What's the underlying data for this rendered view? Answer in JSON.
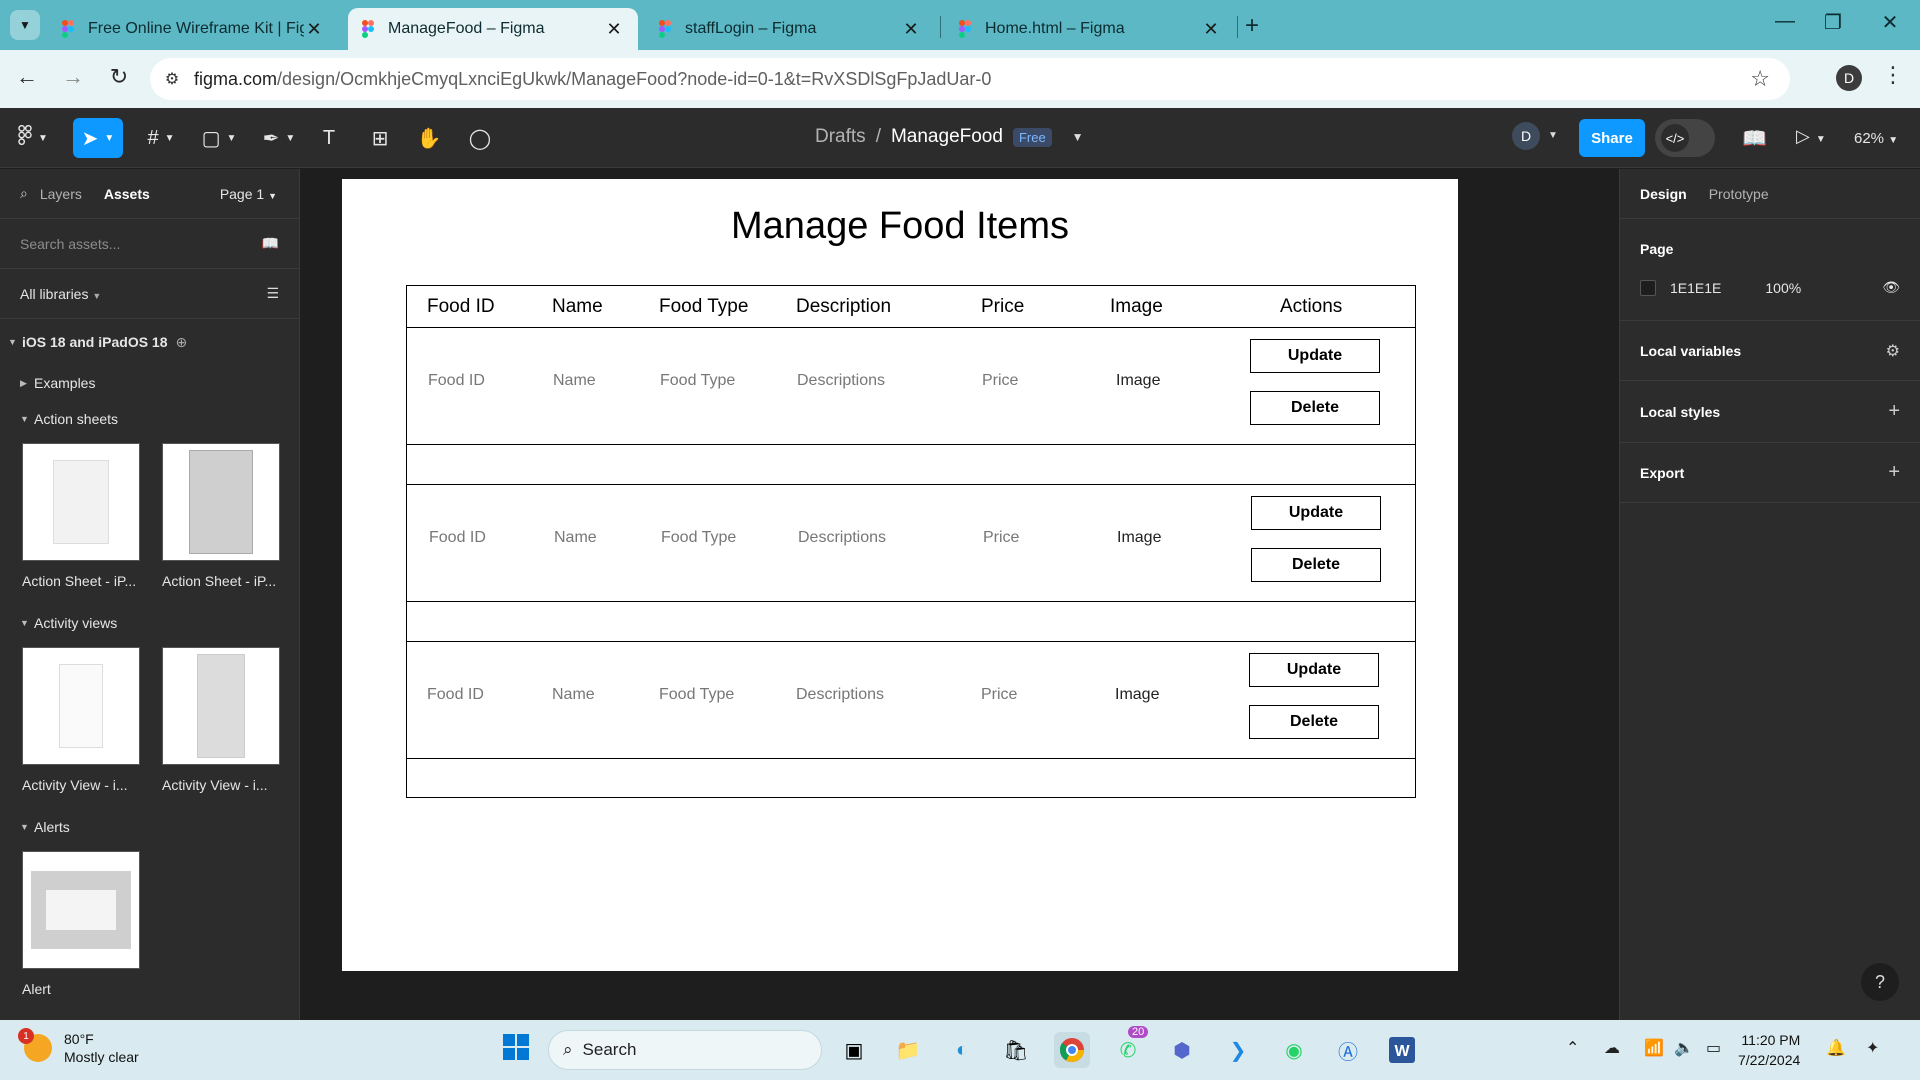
{
  "browser": {
    "tabs": [
      {
        "title": "Free Online Wireframe Kit | Figma",
        "active": false
      },
      {
        "title": "ManageFood – Figma",
        "active": true
      },
      {
        "title": "staffLogin – Figma",
        "active": false
      },
      {
        "title": "Home.html – Figma",
        "active": false
      }
    ],
    "url_host": "figma.com",
    "url_path": "/design/OcmkhjeCmyqLxnciEgUkwk/ManageFood?node-id=0-1&t=RvXSDlSgFpJadUar-0",
    "profile_initial": "D"
  },
  "figma_toolbar": {
    "breadcrumb_folder": "Drafts",
    "breadcrumb_sep": "/",
    "file_name": "ManageFood",
    "plan_badge": "Free",
    "user_initial": "D",
    "share_label": "Share",
    "zoom": "62%"
  },
  "left_panel": {
    "tab_layers": "Layers",
    "tab_assets": "Assets",
    "page_label": "Page 1",
    "search_placeholder": "Search assets...",
    "libraries_label": "All libraries",
    "library_name": "iOS 18 and iPadOS 18",
    "sections": {
      "examples": "Examples",
      "action_sheets": "Action sheets",
      "activity_views": "Activity views",
      "alerts": "Alerts"
    },
    "thumbnails": {
      "action_sheet_1": "Action Sheet - iP...",
      "action_sheet_2": "Action Sheet - iP...",
      "activity_view_1": "Activity View - i...",
      "activity_view_2": "Activity View - i...",
      "alert": "Alert"
    }
  },
  "frame": {
    "title": "Manage Food Items",
    "columns": [
      "Food ID",
      "Name",
      "Food Type",
      "Description",
      "Price",
      "Image",
      "Actions"
    ],
    "rows": [
      {
        "id": "Food ID",
        "name": "Name",
        "type": "Food Type",
        "desc": "Descriptions",
        "price": "Price",
        "image": "Image",
        "update": "Update",
        "delete": "Delete"
      },
      {
        "id": "Food ID",
        "name": "Name",
        "type": "Food Type",
        "desc": "Descriptions",
        "price": "Price",
        "image": "Image",
        "update": "Update",
        "delete": "Delete"
      },
      {
        "id": "Food ID",
        "name": "Name",
        "type": "Food Type",
        "desc": "Descriptions",
        "price": "Price",
        "image": "Image",
        "update": "Update",
        "delete": "Delete"
      }
    ]
  },
  "right_panel": {
    "tab_design": "Design",
    "tab_prototype": "Prototype",
    "page_heading": "Page",
    "page_color": "1E1E1E",
    "page_opacity": "100%",
    "local_variables": "Local variables",
    "local_styles": "Local styles",
    "export": "Export",
    "help": "?"
  },
  "taskbar": {
    "temperature": "80°F",
    "weather": "Mostly clear",
    "weather_badge": "1",
    "search_label": "Search",
    "whatsapp_badge": "20",
    "time": "11:20 PM",
    "date": "7/22/2024"
  },
  "colors": {
    "tabbar": "#5bb8c4",
    "figma_blue": "#0d99ff",
    "canvas_bg": "#1e1e1e",
    "panel_bg": "#2c2c2c"
  }
}
